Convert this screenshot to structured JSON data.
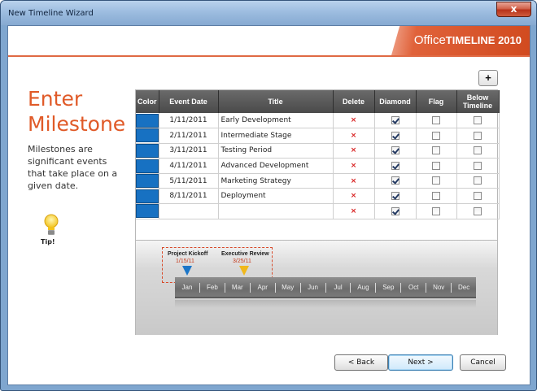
{
  "window": {
    "title": "New Timeline Wizard",
    "close_label": "x"
  },
  "brand": {
    "part1": "Office",
    "part2": "TIMELINE 2010"
  },
  "sidebar": {
    "heading": "Enter Milestone",
    "description": "Milestones are significant events that take place on a given date.",
    "tip_label": "Tip!"
  },
  "toolbar": {
    "add_label": "+"
  },
  "grid": {
    "headers": {
      "color": "Color",
      "event_date": "Event Date",
      "title": "Title",
      "delete": "Delete",
      "diamond": "Diamond",
      "flag": "Flag",
      "below_timeline": "Below Timeline"
    },
    "rows": [
      {
        "date": "1/11/2011",
        "title": "Early Development",
        "delete": "×",
        "diamond": true,
        "flag": false,
        "below": false
      },
      {
        "date": "2/11/2011",
        "title": "Intermediate Stage",
        "delete": "×",
        "diamond": true,
        "flag": false,
        "below": false
      },
      {
        "date": "3/11/2011",
        "title": "Testing Period",
        "delete": "×",
        "diamond": true,
        "flag": false,
        "below": false
      },
      {
        "date": "4/11/2011",
        "title": "Advanced Development",
        "delete": "×",
        "diamond": true,
        "flag": false,
        "below": false
      },
      {
        "date": "5/11/2011",
        "title": "Marketing Strategy",
        "delete": "×",
        "diamond": true,
        "flag": false,
        "below": false
      },
      {
        "date": "8/11/2011",
        "title": "Deployment",
        "delete": "×",
        "diamond": true,
        "flag": false,
        "below": false
      },
      {
        "date": "",
        "title": "",
        "delete": "×",
        "diamond": true,
        "flag": false,
        "below": false
      }
    ],
    "color_hex": "#1771c2"
  },
  "preview": {
    "milestones": [
      {
        "title": "Project Kickoff",
        "date": "1/15/11",
        "color": "#1b76c8"
      },
      {
        "title": "Executive Review",
        "date": "3/25/11",
        "color": "#f0b81c"
      }
    ],
    "months": [
      "Jan",
      "Feb",
      "Mar",
      "Apr",
      "May",
      "Jun",
      "Jul",
      "Aug",
      "Sep",
      "Oct",
      "Nov",
      "Dec"
    ]
  },
  "footer": {
    "back_label": "< Back",
    "next_label": "Next >",
    "cancel_label": "Cancel"
  },
  "colors": {
    "accent": "#e05a28",
    "brand_band": "#d14a1f",
    "frame": "#7fa6cf"
  }
}
